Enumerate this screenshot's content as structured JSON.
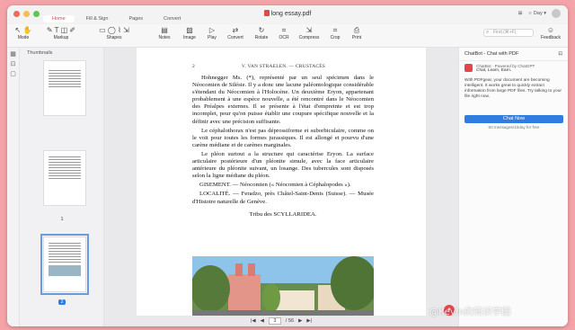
{
  "window": {
    "title": "long essay.pdf",
    "traffic_colors": [
      "#ee6a5f",
      "#f5bf4f",
      "#61c554"
    ],
    "tabs": [
      {
        "label": "Home",
        "active": true
      },
      {
        "label": "Fill & Sign",
        "active": false
      },
      {
        "label": "Pages",
        "active": false
      },
      {
        "label": "Convert",
        "active": false
      }
    ],
    "theme_label": "Day"
  },
  "toolbar": {
    "mode_label": "Mode",
    "markup_label": "Markup",
    "shapes_label": "Shapes",
    "notes_label": "Notes",
    "image_label": "Image",
    "play_label": "Play",
    "convert_label": "Convert",
    "rotate_label": "Rotate",
    "ocr_label": "OCR",
    "compress_label": "Compress",
    "crop_label": "Crop",
    "print_label": "Print",
    "feedback_label": "Feedback",
    "search_placeholder": "Find (⌘+F)"
  },
  "thumbnails": {
    "header": "Thumbnails",
    "pages": [
      {
        "label": "",
        "selected": false
      },
      {
        "label": "1",
        "selected": false
      },
      {
        "label": "2",
        "selected": true
      }
    ]
  },
  "document": {
    "header_left": "2",
    "header_center": "V. VAN STRAELEN. — CRUSTACÉS",
    "paragraphs": [
      "Hohnegger Ms. (*), représenté par un seul spécimen dans le Néocomien de Silésie. Il y a donc une lacune paléontologique considérable s'étendant du Néocomien à l'Holocène. Un deuxième Eryon, appartenant probablement à une espèce nouvelle, a été rencontré dans le Néocomien des Préalpes externes. Il se présente à l'état d'empreinte et est trop incomplet, pour qu'on puisse établir une coupure spécifique nouvelle et la définir avec une précision suffisante.",
      "Le céphalothorax n'est pas déprossiforme et suborbiculaire, comme on le voit pour toutes les formes jurassiques. Il est allongé et pourvu d'une carène médiane et de carènes marginales.",
      "Le pléon surtout a la structure qui caractérise Eryon. La surface articulaire postérieure d'un pléonite simule, avec la face articulaire antérieure du pléonite suivant, un losange. Des tubercules sont disposés selon la ligne médiane du pléon."
    ],
    "gisement": "GISEMENT. — Néocomien (« Néocomien à Céphalopodes »).",
    "localite": "LOCALITÉ. — Feradzo, près Châtel-Saint-Denis (Suisse). — Musée d'Histoire naturelle de Genève.",
    "section_title": "Tribu des SCYLLARIDEA."
  },
  "pagenav": {
    "current_page": "3",
    "total_label": "/ 56"
  },
  "chat": {
    "header": "ChatBot - Chat with PDF",
    "bot_name": "ChatBot · Powered by ChatGPT",
    "bot_tagline": "Chat, Learn, Earn.",
    "description": "With PDFgear, your document are becoming intelligent. It works great to quickly extract information from large PDF files. Try talking to your file right now.",
    "button_label": "Chat Now",
    "quota": "50 messages/10day for free"
  },
  "watermark": "@Kevin的知识学园",
  "colors": {
    "accent": "#e2464c",
    "blue": "#2f7de1",
    "backdrop": "#f4a3a8"
  }
}
